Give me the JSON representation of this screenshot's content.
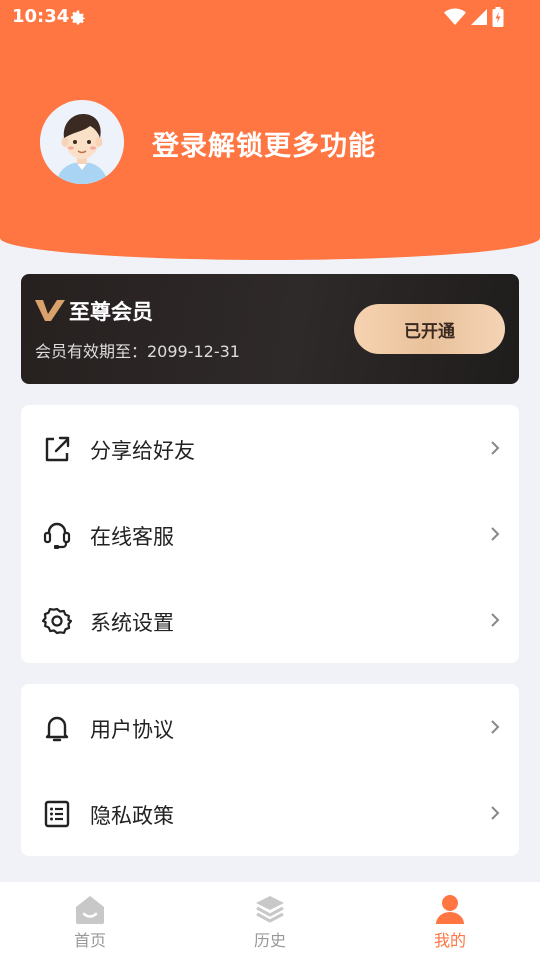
{
  "status_bar": {
    "time": "10:34"
  },
  "header": {
    "login_prompt": "登录解锁更多功能"
  },
  "vip": {
    "title": "至尊会员",
    "expire_text": "会员有效期至：2099-12-31",
    "button_label": "已开通"
  },
  "menu_group_1": [
    {
      "label": "分享给好友",
      "icon": "share-icon"
    },
    {
      "label": "在线客服",
      "icon": "headset-icon"
    },
    {
      "label": "系统设置",
      "icon": "gear-icon"
    }
  ],
  "menu_group_2": [
    {
      "label": "用户协议",
      "icon": "bell-icon"
    },
    {
      "label": "隐私政策",
      "icon": "list-icon"
    }
  ],
  "tabs": [
    {
      "label": "首页",
      "icon": "home-icon"
    },
    {
      "label": "历史",
      "icon": "layers-icon"
    },
    {
      "label": "我的",
      "icon": "user-icon",
      "active": true
    }
  ],
  "colors": {
    "accent": "#ff7642",
    "background": "#f1f2f7",
    "vip_card": "#2a2525",
    "vip_button": "#ecc6a2"
  }
}
